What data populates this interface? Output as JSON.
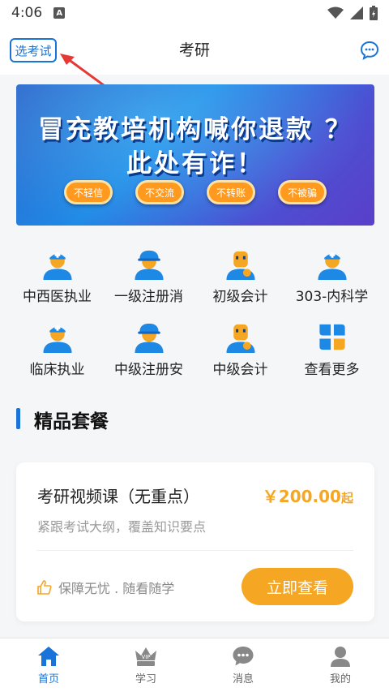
{
  "status_bar": {
    "time": "4:06",
    "notification_badge": "A"
  },
  "header": {
    "select_exam_label": "选考试",
    "title": "考研"
  },
  "banner": {
    "line1": "冒充教培机构喊你退款 ？",
    "line2": "此处有诈！",
    "tags": [
      "不轻信",
      "不交流",
      "不转账",
      "不被骗"
    ]
  },
  "categories": [
    {
      "label": "中西医执业",
      "icon": "doctor-icon"
    },
    {
      "label": "一级注册消",
      "icon": "worker-icon"
    },
    {
      "label": "初级会计",
      "icon": "accountant-icon"
    },
    {
      "label": "303-内科学",
      "icon": "doctor-icon"
    },
    {
      "label": "临床执业",
      "icon": "doctor-icon"
    },
    {
      "label": "中级注册安",
      "icon": "worker-icon"
    },
    {
      "label": "中级会计",
      "icon": "accountant-icon"
    },
    {
      "label": "查看更多",
      "icon": "grid-icon"
    }
  ],
  "section": {
    "title": "精品套餐"
  },
  "package": {
    "name": "考研视频课（无重点）",
    "price": "￥200.00",
    "price_suffix": "起",
    "description": "紧跟考试大纲，覆盖知识要点",
    "guarantee": "保障无忧 . 随看随学",
    "button_label": "立即查看"
  },
  "bottom_nav": [
    {
      "label": "首页",
      "icon": "home-icon",
      "active": true
    },
    {
      "label": "学习",
      "icon": "vip-crown-icon",
      "active": false,
      "badge": "VIP"
    },
    {
      "label": "消息",
      "icon": "message-icon",
      "active": false
    },
    {
      "label": "我的",
      "icon": "profile-icon",
      "active": false
    }
  ],
  "colors": {
    "primary": "#1a73d9",
    "accent": "#f5a623",
    "text": "#222222",
    "muted": "#9a9a9a"
  }
}
